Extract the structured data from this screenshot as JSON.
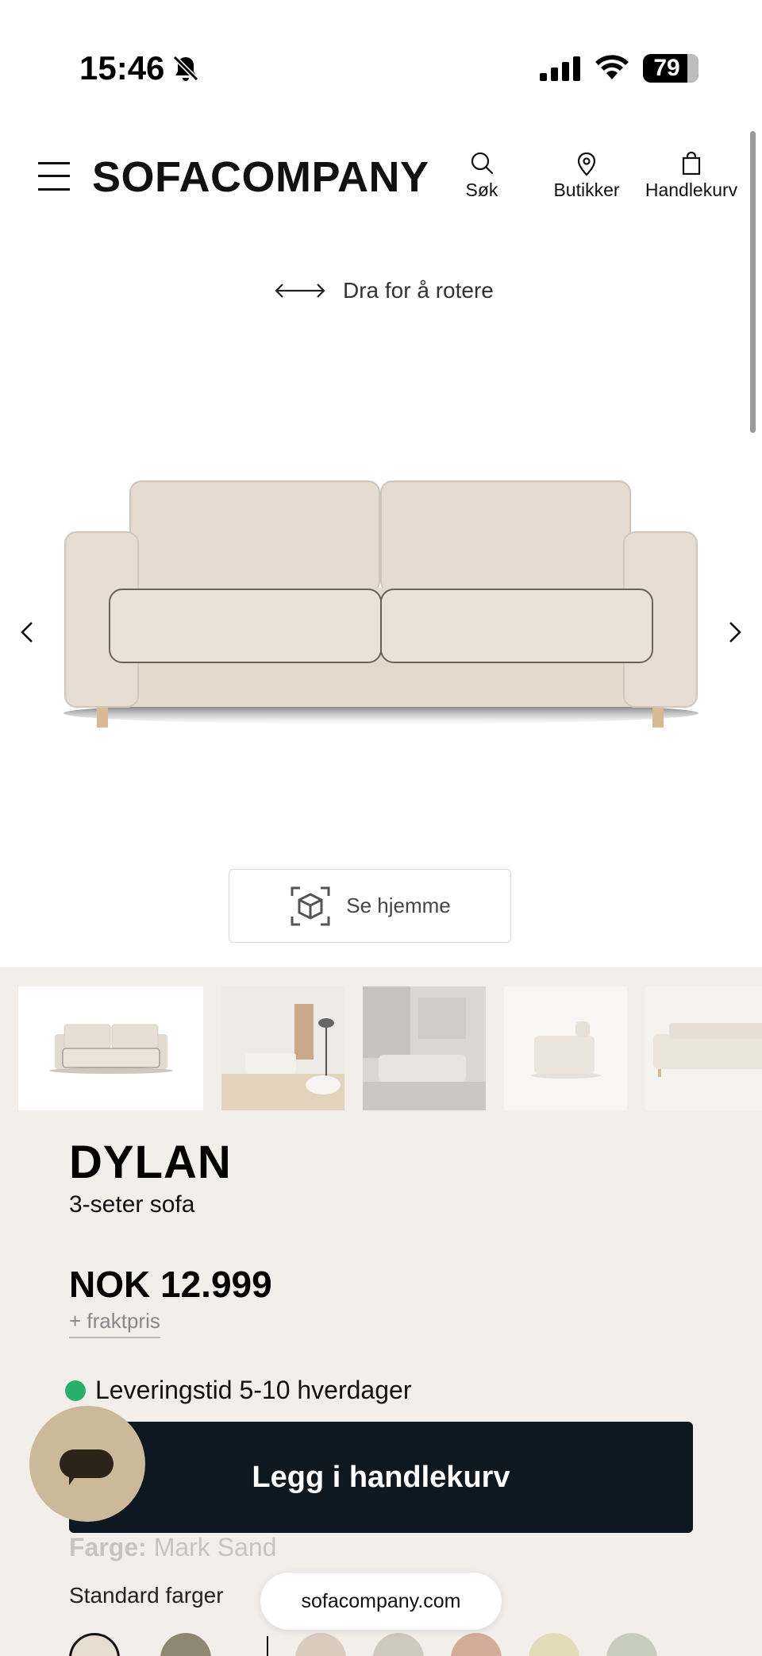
{
  "status_bar": {
    "time": "15:46",
    "battery": "79"
  },
  "header": {
    "logo": "SOFACOMPANY",
    "nav": {
      "search": "Søk",
      "stores": "Butikker",
      "cart": "Handlekurv"
    }
  },
  "viewer": {
    "rotate_hint": "Dra for å rotere",
    "see_home": "Se hjemme"
  },
  "product": {
    "name": "DYLAN",
    "subtitle": "3-seter sofa",
    "price": "NOK 12.999",
    "shipping": "+ fraktpris",
    "delivery": "Leveringstid 5-10 hverdager",
    "add_to_cart": "Legg i handlekurv",
    "color_label": "Farge:",
    "color_value": "Mark Sand",
    "standard_colors": "Standard farger"
  },
  "browser": {
    "url": "sofacompany.com"
  },
  "colors": {
    "panel_bg": "#f2efeb",
    "cta_bg": "#0e1820",
    "delivery_dot": "#2aae6b",
    "chat_bg": "#cbb99a"
  }
}
